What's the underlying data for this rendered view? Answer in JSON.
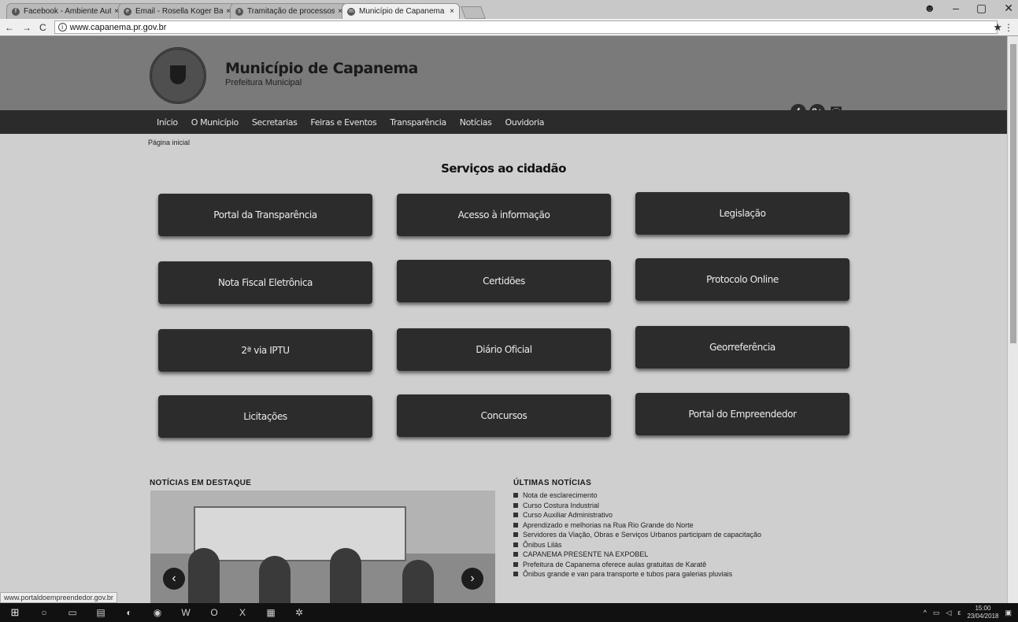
{
  "browser": {
    "tabs": [
      {
        "icon": "f",
        "label": "Facebook - Ambiente Autonomo Cargueiros"
      },
      {
        "icon": "e",
        "label": "Email - Rosella Koger Batista"
      },
      {
        "icon": "s",
        "label": "Tramitação de processos"
      },
      {
        "icon": "m",
        "label": "Município de Capanema"
      }
    ],
    "url": "www.capanema.pr.gov.br",
    "status_url": "www.portaldoempreendedor.gov.br"
  },
  "site": {
    "title": "Município de Capanema",
    "subtitle": "Prefeitura Municipal",
    "social": [
      "f",
      "8+",
      "✉"
    ],
    "nav": [
      "Início",
      "O Município",
      "Secretarias",
      "Feiras e Eventos",
      "Transparência",
      "Notícias",
      "Ouvidoria"
    ],
    "breadcrumb": "Página inicial",
    "services_title": "Serviços ao cidadão",
    "services": [
      [
        "Portal da Transparência",
        "Acesso à informação",
        "Legislação"
      ],
      [
        "Nota Fiscal Eletrônica",
        "Certidões",
        "Protocolo Online"
      ],
      [
        "2ª via IPTU",
        "Diário Oficial",
        "Georreferência"
      ],
      [
        "Licitações",
        "Concursos",
        "Portal do Empreendedor"
      ]
    ],
    "featured_title": "NOTÍCIAS EM DESTAQUE",
    "latest_title": "ÚLTIMAS NOTÍCIAS",
    "latest_news": [
      "Nota de esclarecimento",
      "Curso Costura Industrial",
      "Curso Auxiliar Administrativo",
      "Aprendizado e melhorias na Rua Rio Grande do Norte",
      "Servidores da Viação, Obras e Serviços Urbanos participam de capacitação",
      "Ônibus Lilás",
      "CAPANEMA PRESENTE NA EXPOBEL",
      "Prefeitura de Capanema oferece aulas gratuitas de Karatê",
      "Ônibus grande e van para transporte e tubos para galerias pluviais"
    ]
  },
  "taskbar": {
    "time": "15:00",
    "date": "23/04/2018"
  }
}
